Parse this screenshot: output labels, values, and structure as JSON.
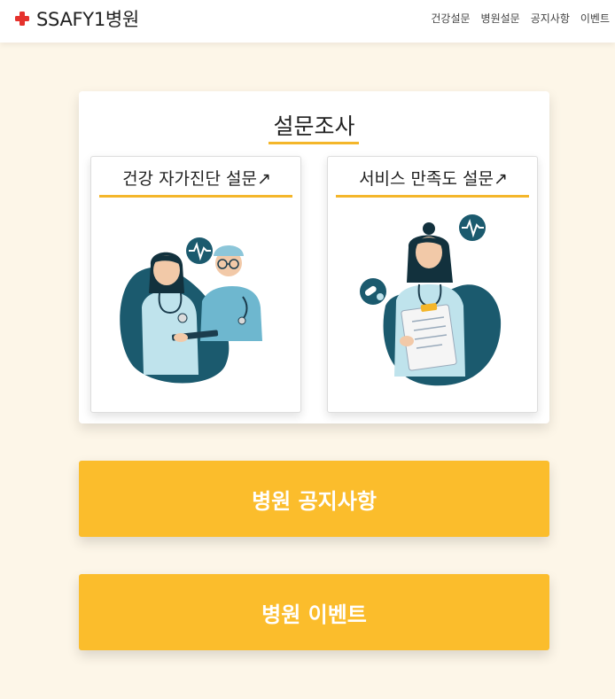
{
  "header": {
    "brand": "SSAFY1병원",
    "nav": [
      "건강설문",
      "병원설문",
      "공지사항",
      "이벤트"
    ]
  },
  "survey": {
    "title": "설문조사",
    "cards": [
      {
        "title": "건강 자가진단 설문↗",
        "icon": "doctors-illustration"
      },
      {
        "title": "서비스 만족도 설문↗",
        "icon": "nurse-clipboard-illustration"
      }
    ]
  },
  "buttons": {
    "notice": "병원 공지사항",
    "event": "병원 이벤트"
  },
  "colors": {
    "accent": "#fbbd2c",
    "background": "#fdf6e8",
    "brand_cross": "#e5322d",
    "illustration_dark": "#1b5a6e",
    "illustration_light": "#bfe3ec"
  }
}
